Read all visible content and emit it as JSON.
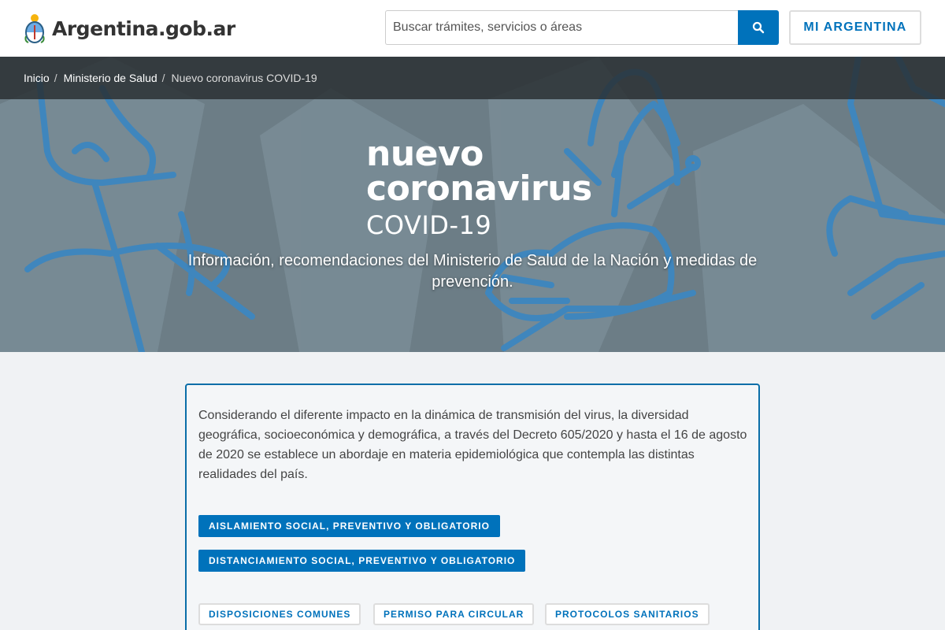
{
  "header": {
    "logo_text": "Argentina.gob.ar",
    "search_placeholder": "Buscar trámites, servicios o áreas",
    "search_icon": "search-icon",
    "mi_argentina_label": "MI ARGENTINA"
  },
  "breadcrumb": {
    "items": [
      "Inicio",
      "Ministerio de Salud",
      "Nuevo coronavirus COVID-19"
    ]
  },
  "hero": {
    "title_line1": "nuevo",
    "title_line2": "coronavirus",
    "title_line3": "COVID-19",
    "subtitle": "Información, recomendaciones del Ministerio de Salud de la Nación y medidas de prevención."
  },
  "card": {
    "text": "Considerando el diferente impacto en la dinámica de transmisión del virus, la diversidad geográfica, socioeconómica y demográfica, a través del Decreto 605/2020 y hasta el 16 de agosto de 2020 se establece un abordaje en materia epidemiológica que contempla las distintas realidades del país.",
    "primary_buttons": [
      "AISLAMIENTO SOCIAL, PREVENTIVO Y OBLIGATORIO",
      "DISTANCIAMIENTO SOCIAL, PREVENTIVO Y OBLIGATORIO"
    ],
    "secondary_buttons": [
      "DISPOSICIONES COMUNES",
      "PERMISO PARA CIRCULAR",
      "PROTOCOLOS SANITARIOS"
    ]
  },
  "colors": {
    "primary": "#0072bb",
    "hero_bg": "#6c7d86",
    "hero_art": "#4a8cbf",
    "breadcrumb_bg": "#282d30"
  }
}
